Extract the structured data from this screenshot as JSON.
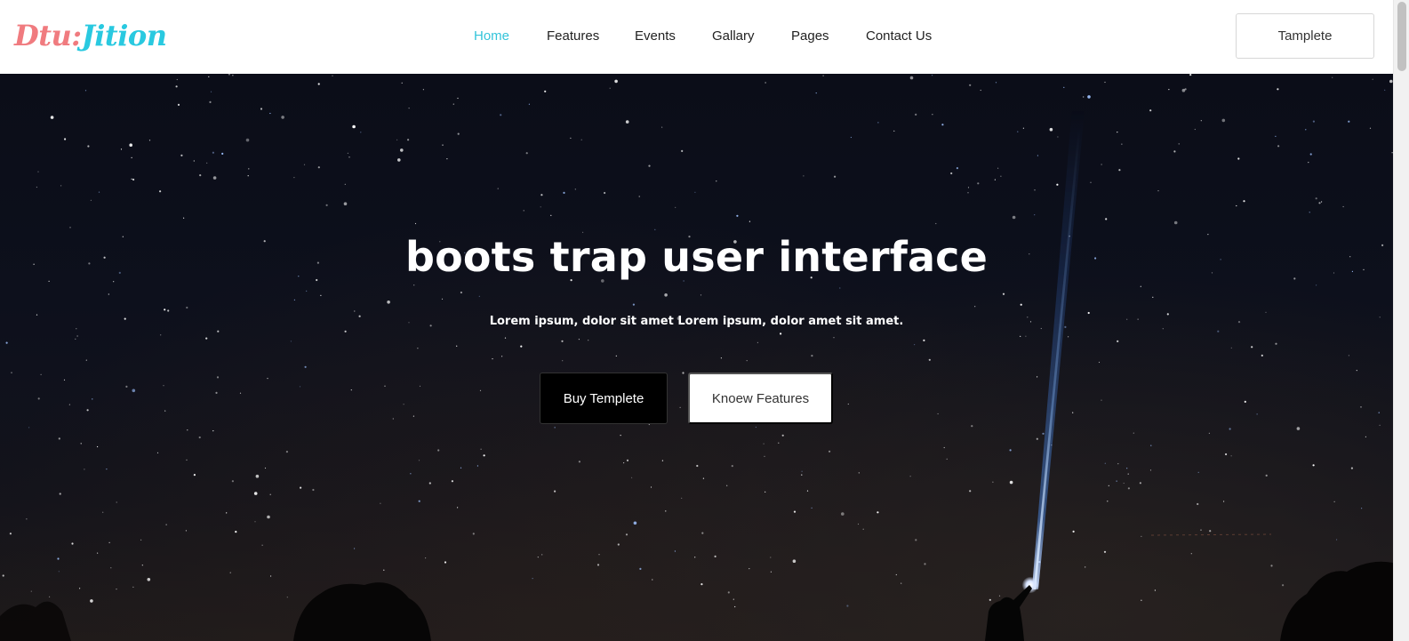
{
  "brand": {
    "logo_part_a": "Dtu:",
    "logo_part_b": "Jition",
    "colors": {
      "logo_a": "#f07b7f",
      "logo_b": "#29c9e0",
      "accent": "#34c4da"
    }
  },
  "nav": {
    "items": [
      {
        "label": "Home",
        "active": true
      },
      {
        "label": "Features",
        "active": false
      },
      {
        "label": "Events",
        "active": false
      },
      {
        "label": "Gallary",
        "active": false
      },
      {
        "label": "Pages",
        "active": false
      },
      {
        "label": "Contact Us",
        "active": false
      }
    ],
    "cta_label": "Tamplete"
  },
  "hero": {
    "title": "boots trap user interface",
    "subtitle": "Lorem ipsum, dolor sit amet Lorem ipsum, dolor amet sit amet.",
    "primary_button": "Buy Templete",
    "secondary_button": "Knoew Features"
  }
}
